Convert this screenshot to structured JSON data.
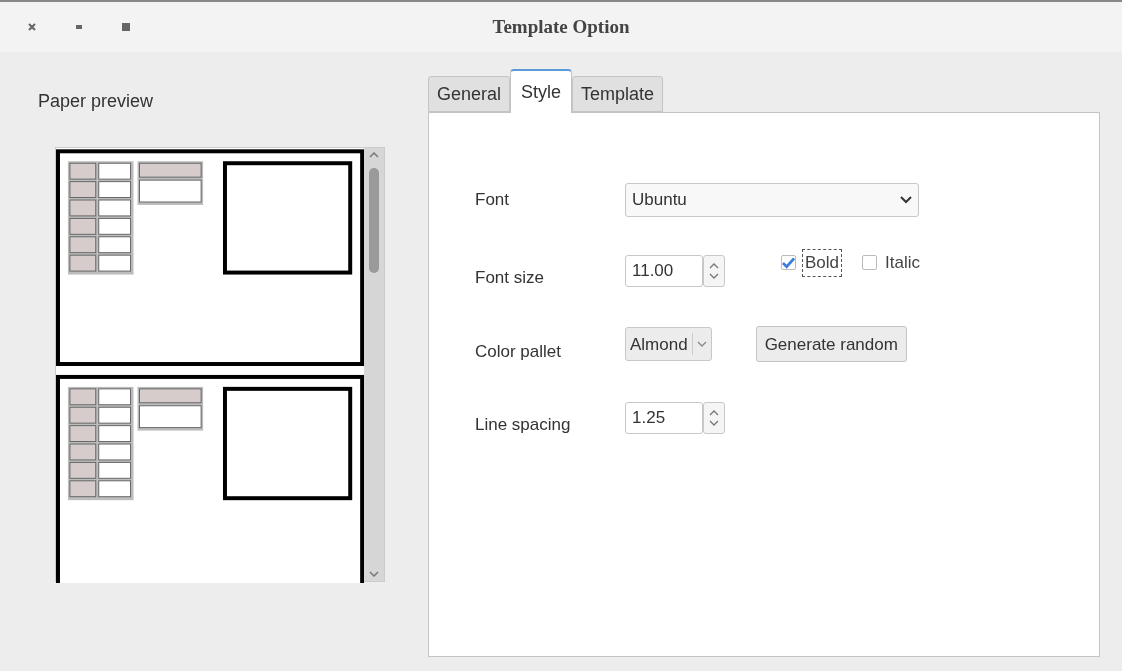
{
  "window": {
    "title": "Template Option"
  },
  "preview": {
    "label": "Paper preview"
  },
  "tabs": [
    {
      "label": "General",
      "selected": false
    },
    {
      "label": "Style",
      "selected": true
    },
    {
      "label": "Template",
      "selected": false
    }
  ],
  "style": {
    "font": {
      "label": "Font",
      "value": "Ubuntu"
    },
    "font_size": {
      "label": "Font size",
      "value": "11.00"
    },
    "bold": {
      "label": "Bold",
      "checked": true
    },
    "italic": {
      "label": "Italic",
      "checked": false
    },
    "color_pallet": {
      "label": "Color pallet",
      "value": "Almond"
    },
    "generate_button": "Generate random",
    "line_spacing": {
      "label": "Line spacing",
      "value": "1.25"
    }
  }
}
